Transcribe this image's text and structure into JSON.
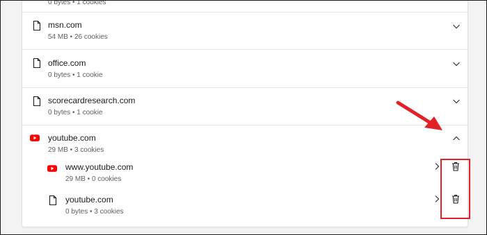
{
  "sites": [
    {
      "name": "",
      "details": "0 bytes • 1 cookies"
    },
    {
      "name": "msn.com",
      "details": "54 MB • 26 cookies"
    },
    {
      "name": "office.com",
      "details": "0 bytes • 1 cookie"
    },
    {
      "name": "scorecardresearch.com",
      "details": "0 bytes • 1 cookie"
    },
    {
      "name": "youtube.com",
      "details": "29 MB • 3 cookies"
    }
  ],
  "subsites": [
    {
      "name": "www.youtube.com",
      "details": "29 MB • 0 cookies"
    },
    {
      "name": "youtube.com",
      "details": "0 bytes • 3 cookies"
    }
  ],
  "icons": {
    "file": "file-icon",
    "youtube": "youtube-icon",
    "chevron_down": "chevron-down-icon",
    "chevron_up": "chevron-up-icon",
    "chevron_right": "chevron-right-icon",
    "trash": "trash-icon"
  },
  "colors": {
    "youtube_red": "#ff0000",
    "annotation_red": "#e1202a",
    "divider": "#e6e6e6",
    "secondary_text": "#616161"
  }
}
